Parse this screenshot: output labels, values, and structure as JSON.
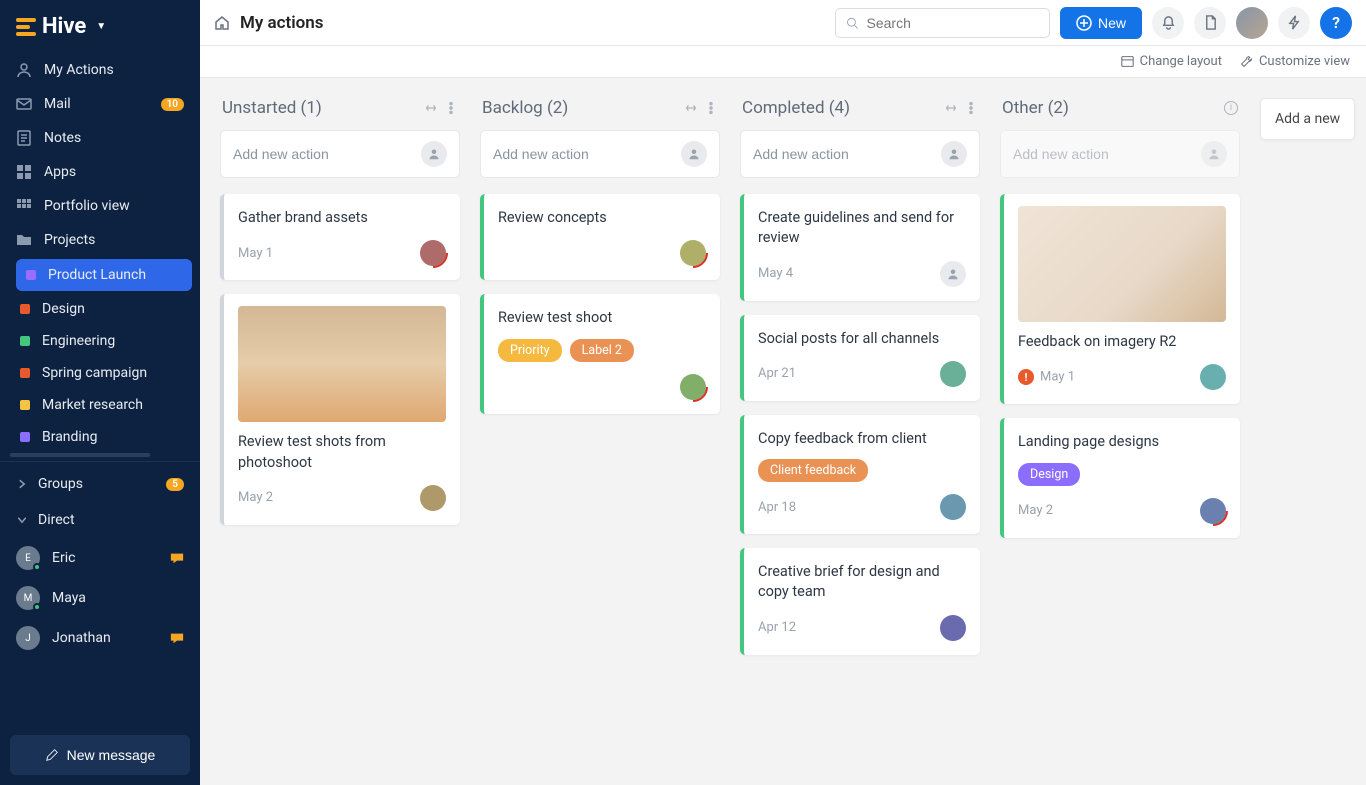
{
  "brand": {
    "name": "Hive"
  },
  "sidebar": {
    "items": [
      {
        "label": "My Actions",
        "icon": "user-icon"
      },
      {
        "label": "Mail",
        "icon": "mail-icon",
        "badge": "10"
      },
      {
        "label": "Notes",
        "icon": "note-icon"
      },
      {
        "label": "Apps",
        "icon": "apps-icon"
      },
      {
        "label": "Portfolio view",
        "icon": "grid-icon"
      },
      {
        "label": "Projects",
        "icon": "folder-icon"
      }
    ],
    "projects": [
      {
        "label": "Product Launch",
        "color": "#9b6dff",
        "active": true
      },
      {
        "label": "Design",
        "color": "#e8592b"
      },
      {
        "label": "Engineering",
        "color": "#43c77e"
      },
      {
        "label": "Spring campaign",
        "color": "#e8592b"
      },
      {
        "label": "Market research",
        "color": "#f5c542"
      },
      {
        "label": "Branding",
        "color": "#8b6dff"
      }
    ],
    "groups": {
      "label": "Groups",
      "badge": "5"
    },
    "direct": {
      "label": "Direct"
    },
    "dms": [
      {
        "name": "Eric",
        "status": "#43c77e",
        "hasMsg": true
      },
      {
        "name": "Maya",
        "status": "#43c77e"
      },
      {
        "name": "Jonathan",
        "status": "",
        "hasMsg": true
      }
    ],
    "newMessage": "New message"
  },
  "header": {
    "title": "My actions",
    "searchPlaceholder": "Search",
    "newLabel": "New"
  },
  "subbar": {
    "layout": "Change layout",
    "customize": "Customize view"
  },
  "board": {
    "addActionPlaceholder": "Add new action",
    "addColumn": "Add a new",
    "columns": [
      {
        "title": "Unstarted (1)",
        "color": "#d0d5db",
        "cards": [
          {
            "title": "Gather brand assets",
            "date": "May 1",
            "avatar": true,
            "ring": true
          },
          {
            "title": "Review test shots from photoshoot",
            "date": "May 2",
            "avatar": true,
            "img": "img1"
          }
        ]
      },
      {
        "title": "Backlog (2)",
        "color": "#43c77e",
        "cards": [
          {
            "title": "Review concepts",
            "date": "",
            "avatar": true,
            "ring": true
          },
          {
            "title": "Review test shoot",
            "labels": [
              {
                "text": "Priority",
                "color": "#f5b940"
              },
              {
                "text": "Label 2",
                "color": "#ea9254"
              }
            ],
            "avatar": true,
            "ring": true
          }
        ]
      },
      {
        "title": "Completed (4)",
        "color": "#43c77e",
        "cards": [
          {
            "title": "Create guidelines and send for review",
            "date": "May 4",
            "placeholder": true
          },
          {
            "title": "Social posts for all channels",
            "date": "Apr 21",
            "avatar": true
          },
          {
            "title": "Copy feedback from client",
            "date": "Apr 18",
            "labels": [
              {
                "text": "Client feedback",
                "color": "#ea9254"
              }
            ],
            "avatar": true
          },
          {
            "title": "Creative brief for design and copy team",
            "date": "Apr 12",
            "avatar": true
          }
        ]
      },
      {
        "title": "Other (2)",
        "color": "#43c77e",
        "info": true,
        "disabled": true,
        "cards": [
          {
            "title": "Feedback on imagery R2",
            "date": "May 1",
            "avatar": true,
            "img": "img2",
            "alert": true
          },
          {
            "title": "Landing page designs",
            "date": "May 2",
            "labels": [
              {
                "text": "Design",
                "color": "#8b6dff"
              }
            ],
            "avatar": true,
            "ring": true
          }
        ]
      }
    ]
  }
}
